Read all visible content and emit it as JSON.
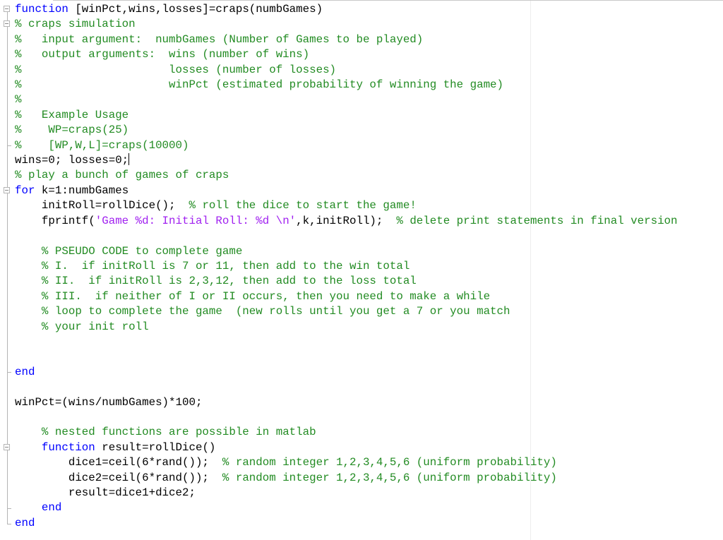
{
  "editor": {
    "language": "matlab",
    "file_function": "craps",
    "lines": [
      {
        "segments": [
          {
            "t": "kw",
            "v": "function"
          },
          {
            "t": "code",
            "v": " [winPct,wins,losses]=craps(numbGames)"
          }
        ]
      },
      {
        "segments": [
          {
            "t": "cm",
            "v": "% craps simulation"
          }
        ]
      },
      {
        "segments": [
          {
            "t": "cm",
            "v": "%   input argument:  numbGames (Number of Games to be played)"
          }
        ]
      },
      {
        "segments": [
          {
            "t": "cm",
            "v": "%   output arguments:  wins (number of wins)"
          }
        ]
      },
      {
        "segments": [
          {
            "t": "cm",
            "v": "%                      losses (number of losses)"
          }
        ]
      },
      {
        "segments": [
          {
            "t": "cm",
            "v": "%                      winPct (estimated probability of winning the game)"
          }
        ]
      },
      {
        "segments": [
          {
            "t": "cm",
            "v": "%"
          }
        ]
      },
      {
        "segments": [
          {
            "t": "cm",
            "v": "%   Example Usage"
          }
        ]
      },
      {
        "segments": [
          {
            "t": "cm",
            "v": "%    WP=craps(25)"
          }
        ]
      },
      {
        "segments": [
          {
            "t": "cm",
            "v": "%    [WP,W,L]=craps(10000)"
          }
        ]
      },
      {
        "segments": [
          {
            "t": "code",
            "v": "wins=0; losses=0;"
          }
        ],
        "caret": true
      },
      {
        "segments": [
          {
            "t": "cm",
            "v": "% play a bunch of games of craps"
          }
        ]
      },
      {
        "segments": [
          {
            "t": "kw",
            "v": "for"
          },
          {
            "t": "code",
            "v": " k=1:numbGames"
          }
        ]
      },
      {
        "segments": [
          {
            "t": "code",
            "v": "    initRoll=rollDice();  "
          },
          {
            "t": "cm",
            "v": "% roll the dice to start the game!"
          }
        ]
      },
      {
        "segments": [
          {
            "t": "code",
            "v": "    fprintf("
          },
          {
            "t": "str",
            "v": "'Game %d: Initial Roll: %d \\n'"
          },
          {
            "t": "code",
            "v": ",k,initRoll);  "
          },
          {
            "t": "cm",
            "v": "% delete print statements in final version"
          }
        ]
      },
      {
        "segments": [
          {
            "t": "code",
            "v": ""
          }
        ]
      },
      {
        "segments": [
          {
            "t": "code",
            "v": "    "
          },
          {
            "t": "cm",
            "v": "% PSEUDO CODE to complete game"
          }
        ]
      },
      {
        "segments": [
          {
            "t": "code",
            "v": "    "
          },
          {
            "t": "cm",
            "v": "% I.  if initRoll is 7 or 11, then add to the win total"
          }
        ]
      },
      {
        "segments": [
          {
            "t": "code",
            "v": "    "
          },
          {
            "t": "cm",
            "v": "% II.  if initRoll is 2,3,12, then add to the loss total"
          }
        ]
      },
      {
        "segments": [
          {
            "t": "code",
            "v": "    "
          },
          {
            "t": "cm",
            "v": "% III.  if neither of I or II occurs, then you need to make a while"
          }
        ]
      },
      {
        "segments": [
          {
            "t": "code",
            "v": "    "
          },
          {
            "t": "cm",
            "v": "% loop to complete the game  (new rolls until you get a 7 or you match"
          }
        ]
      },
      {
        "segments": [
          {
            "t": "code",
            "v": "    "
          },
          {
            "t": "cm",
            "v": "% your init roll"
          }
        ]
      },
      {
        "segments": [
          {
            "t": "code",
            "v": ""
          }
        ]
      },
      {
        "segments": [
          {
            "t": "code",
            "v": ""
          }
        ]
      },
      {
        "segments": [
          {
            "t": "kw",
            "v": "end"
          }
        ]
      },
      {
        "segments": [
          {
            "t": "code",
            "v": ""
          }
        ]
      },
      {
        "segments": [
          {
            "t": "code",
            "v": "winPct=(wins/numbGames)*100;"
          }
        ]
      },
      {
        "segments": [
          {
            "t": "code",
            "v": ""
          }
        ]
      },
      {
        "segments": [
          {
            "t": "code",
            "v": "    "
          },
          {
            "t": "cm",
            "v": "% nested functions are possible in matlab"
          }
        ]
      },
      {
        "segments": [
          {
            "t": "code",
            "v": "    "
          },
          {
            "t": "kw",
            "v": "function"
          },
          {
            "t": "code",
            "v": " result=rollDice()"
          }
        ]
      },
      {
        "segments": [
          {
            "t": "code",
            "v": "        dice1=ceil(6*rand());  "
          },
          {
            "t": "cm",
            "v": "% random integer 1,2,3,4,5,6 (uniform probability)"
          }
        ]
      },
      {
        "segments": [
          {
            "t": "code",
            "v": "        dice2=ceil(6*rand());  "
          },
          {
            "t": "cm",
            "v": "% random integer 1,2,3,4,5,6 (uniform probability)"
          }
        ]
      },
      {
        "segments": [
          {
            "t": "code",
            "v": "        result=dice1+dice2;"
          }
        ]
      },
      {
        "segments": [
          {
            "t": "code",
            "v": "    "
          },
          {
            "t": "kw",
            "v": "end"
          }
        ]
      },
      {
        "segments": [
          {
            "t": "kw",
            "v": "end"
          }
        ]
      }
    ]
  },
  "colors": {
    "keyword": "#0000ff",
    "comment": "#228b22",
    "string": "#a020f0",
    "text": "#000000",
    "background": "#ffffff"
  },
  "gutter": {
    "icons": [
      "fold-collapse-icon",
      "fold-line-icon"
    ]
  }
}
